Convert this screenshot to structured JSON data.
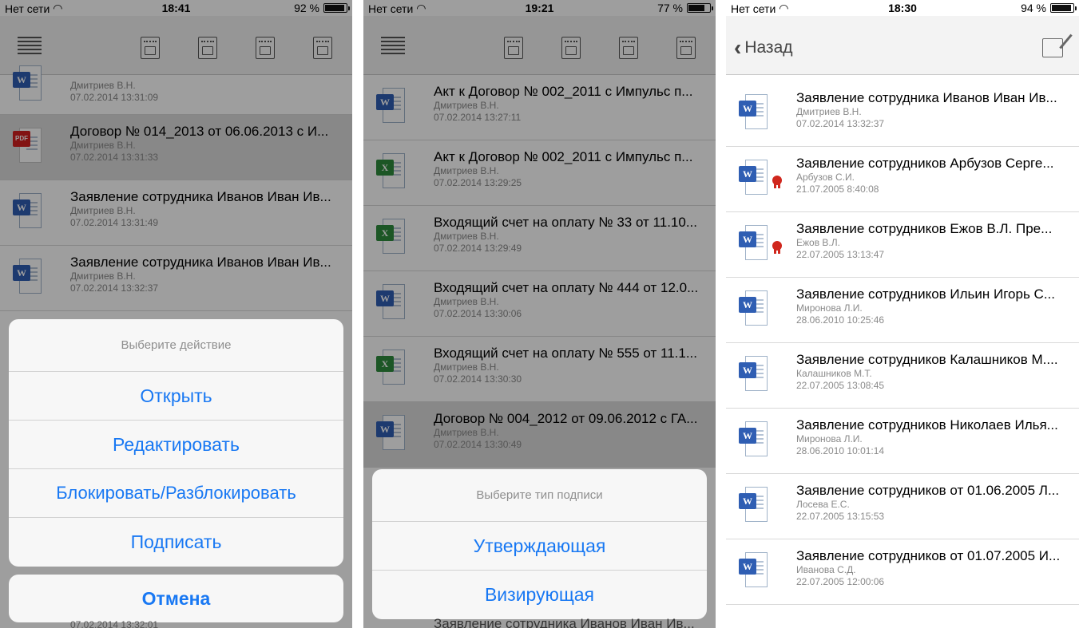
{
  "screens": [
    {
      "status": {
        "carrier": "Нет сети",
        "time": "18:41",
        "battery": "92 %",
        "battery_level": 0.92
      },
      "toolbar_icons": [
        "menu-icon",
        "new-document-icon",
        "edit-document-icon",
        "envelope-document-icon",
        "file-document-icon"
      ],
      "documents": [
        {
          "type": "word",
          "title": "",
          "author": "Дмитриев В.Н.",
          "date": "07.02.2014 13:31:09",
          "highlighted": false
        },
        {
          "type": "pdf",
          "title": "Договор № 014_2013 от 06.06.2013 с И...",
          "author": "Дмитриев В.Н.",
          "date": "07.02.2014 13:31:33",
          "highlighted": true
        },
        {
          "type": "word",
          "title": "Заявление сотрудника Иванов Иван Ив...",
          "author": "Дмитриев В.Н.",
          "date": "07.02.2014 13:31:49",
          "highlighted": false
        },
        {
          "type": "word",
          "title": "Заявление сотрудника Иванов Иван Ив...",
          "author": "Дмитриев В.Н.",
          "date": "07.02.2014 13:32:37",
          "highlighted": false
        }
      ],
      "action_sheet": {
        "header": "Выберите действие",
        "actions": [
          "Открыть",
          "Редактировать",
          "Блокировать/Разблокировать",
          "Подписать"
        ],
        "cancel": "Отмена"
      },
      "footer_date": "07.02.2014 13:32:01"
    },
    {
      "status": {
        "carrier": "Нет сети",
        "time": "19:21",
        "battery": "77 %",
        "battery_level": 0.77
      },
      "toolbar_icons": [
        "menu-icon",
        "new-document-icon",
        "edit-document-icon",
        "envelope-document-icon",
        "file-document-icon"
      ],
      "documents": [
        {
          "type": "word",
          "title": "Акт к Договор № 002_2011 с Импульс п...",
          "author": "Дмитриев В.Н.",
          "date": "07.02.2014 13:27:11",
          "highlighted": false
        },
        {
          "type": "excel",
          "title": "Акт к Договор № 002_2011 с Импульс п...",
          "author": "Дмитриев В.Н.",
          "date": "07.02.2014 13:29:25",
          "highlighted": false
        },
        {
          "type": "excel",
          "title": "Входящий счет на оплату № 33 от 11.10...",
          "author": "Дмитриев В.Н.",
          "date": "07.02.2014 13:29:49",
          "highlighted": false
        },
        {
          "type": "word",
          "title": "Входящий счет на оплату № 444 от 12.0...",
          "author": "Дмитриев В.Н.",
          "date": "07.02.2014 13:30:06",
          "highlighted": false
        },
        {
          "type": "excel",
          "title": "Входящий счет на оплату № 555 от 11.1...",
          "author": "Дмитриев В.Н.",
          "date": "07.02.2014 13:30:30",
          "highlighted": false
        },
        {
          "type": "word",
          "title": "Договор № 004_2012 от 09.06.2012 с ГА...",
          "author": "Дмитриев В.Н.",
          "date": "07.02.2014 13:30:49",
          "highlighted": true
        }
      ],
      "action_sheet": {
        "header": "Выберите тип подписи",
        "actions": [
          "Утверждающая",
          "Визирующая"
        ]
      },
      "footer_title": "Заявление сотрудника Иванов Иван Ив..."
    },
    {
      "status": {
        "carrier": "Нет сети",
        "time": "18:30",
        "battery": "94 %",
        "battery_level": 0.94
      },
      "nav": {
        "back_label": "Назад"
      },
      "documents": [
        {
          "type": "word",
          "title": "Заявление сотрудника Иванов Иван Ив...",
          "author": "Дмитриев В.Н.",
          "date": "07.02.2014 13:32:37",
          "signed": false
        },
        {
          "type": "word",
          "title": "Заявление сотрудников Арбузов Серге...",
          "author": "Арбузов С.И.",
          "date": "21.07.2005 8:40:08",
          "signed": true
        },
        {
          "type": "word",
          "title": "Заявление сотрудников Ежов В.Л. Пре...",
          "author": "Ежов В.Л.",
          "date": "22.07.2005 13:13:47",
          "signed": true
        },
        {
          "type": "word",
          "title": "Заявление сотрудников Ильин Игорь С...",
          "author": "Миронова Л.И.",
          "date": "28.06.2010 10:25:46",
          "signed": false
        },
        {
          "type": "word",
          "title": "Заявление сотрудников Калашников М....",
          "author": "Калашников М.Т.",
          "date": "22.07.2005 13:08:45",
          "signed": false
        },
        {
          "type": "word",
          "title": "Заявление сотрудников Николаев Илья...",
          "author": "Миронова Л.И.",
          "date": "28.06.2010 10:01:14",
          "signed": false
        },
        {
          "type": "word",
          "title": "Заявление сотрудников от 01.06.2005 Л...",
          "author": "Лосева Е.С.",
          "date": "22.07.2005 13:15:53",
          "signed": false
        },
        {
          "type": "word",
          "title": "Заявление сотрудников от 01.07.2005 И...",
          "author": "Иванова С.Д.",
          "date": "22.07.2005 12:00:06",
          "signed": false
        }
      ]
    }
  ]
}
